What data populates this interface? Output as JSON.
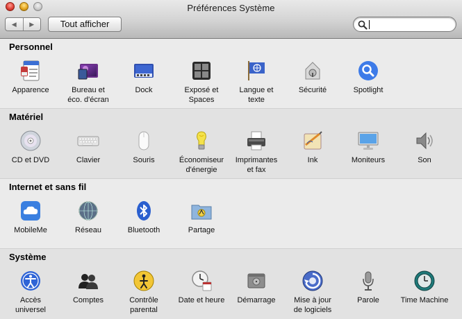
{
  "window": {
    "title": "Préférences Système"
  },
  "toolbar": {
    "back_glyph": "◀",
    "forward_glyph": "▶",
    "show_all_label": "Tout afficher",
    "search_value": "",
    "search_placeholder": ""
  },
  "sections": [
    {
      "title": "Personnel",
      "items": [
        {
          "label": "Apparence",
          "icon": "appearance-icon"
        },
        {
          "label": "Bureau et\néco. d'écran",
          "icon": "desktop-screensaver-icon"
        },
        {
          "label": "Dock",
          "icon": "dock-icon"
        },
        {
          "label": "Exposé et\nSpaces",
          "icon": "expose-spaces-icon"
        },
        {
          "label": "Langue et\ntexte",
          "icon": "language-text-icon"
        },
        {
          "label": "Sécurité",
          "icon": "security-icon"
        },
        {
          "label": "Spotlight",
          "icon": "spotlight-icon"
        }
      ]
    },
    {
      "title": "Matériel",
      "items": [
        {
          "label": "CD et DVD",
          "icon": "cd-dvd-icon"
        },
        {
          "label": "Clavier",
          "icon": "keyboard-icon"
        },
        {
          "label": "Souris",
          "icon": "mouse-icon"
        },
        {
          "label": "Économiseur\nd'énergie",
          "icon": "energy-saver-icon"
        },
        {
          "label": "Imprimantes\net fax",
          "icon": "printer-icon"
        },
        {
          "label": "Ink",
          "icon": "ink-icon"
        },
        {
          "label": "Moniteurs",
          "icon": "displays-icon"
        },
        {
          "label": "Son",
          "icon": "sound-icon"
        }
      ]
    },
    {
      "title": "Internet et sans fil",
      "items": [
        {
          "label": "MobileMe",
          "icon": "mobileme-icon"
        },
        {
          "label": "Réseau",
          "icon": "network-icon"
        },
        {
          "label": "Bluetooth",
          "icon": "bluetooth-icon"
        },
        {
          "label": "Partage",
          "icon": "sharing-icon"
        }
      ]
    },
    {
      "title": "Système",
      "items": [
        {
          "label": "Accès\nuniversel",
          "icon": "universal-access-icon"
        },
        {
          "label": "Comptes",
          "icon": "accounts-icon"
        },
        {
          "label": "Contrôle\nparental",
          "icon": "parental-controls-icon"
        },
        {
          "label": "Date et heure",
          "icon": "date-time-icon"
        },
        {
          "label": "Démarrage",
          "icon": "startup-disk-icon"
        },
        {
          "label": "Mise à jour\nde logiciels",
          "icon": "software-update-icon"
        },
        {
          "label": "Parole",
          "icon": "speech-icon"
        },
        {
          "label": "Time Machine",
          "icon": "time-machine-icon"
        }
      ]
    }
  ]
}
